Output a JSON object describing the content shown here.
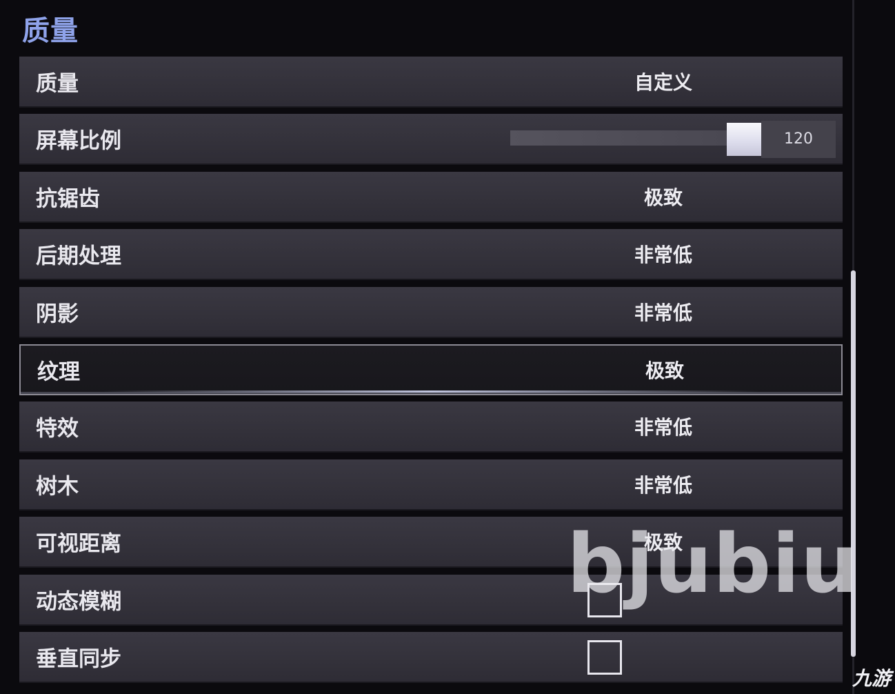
{
  "section": {
    "title": "质量"
  },
  "rows": [
    {
      "label": "质量",
      "value": "自定义"
    },
    {
      "label": "屏幕比例",
      "slider_value": "120",
      "slider_fraction": 0.77
    },
    {
      "label": "抗锯齿",
      "value": "极致"
    },
    {
      "label": "后期处理",
      "value": "非常低"
    },
    {
      "label": "阴影",
      "value": "非常低"
    },
    {
      "label": "纹理",
      "value": "极致"
    },
    {
      "label": "特效",
      "value": "非常低"
    },
    {
      "label": "树木",
      "value": "非常低"
    },
    {
      "label": "可视距离",
      "value": "极致"
    },
    {
      "label": "动态模糊",
      "checked": false
    },
    {
      "label": "垂直同步",
      "checked": false
    }
  ],
  "watermark": {
    "text": "bjubiu"
  },
  "corner_logo": {
    "text": "九游"
  },
  "colors": {
    "title": "#8fa3ea",
    "row_bg": "#36343d",
    "selected_border": "#8d8b95"
  }
}
